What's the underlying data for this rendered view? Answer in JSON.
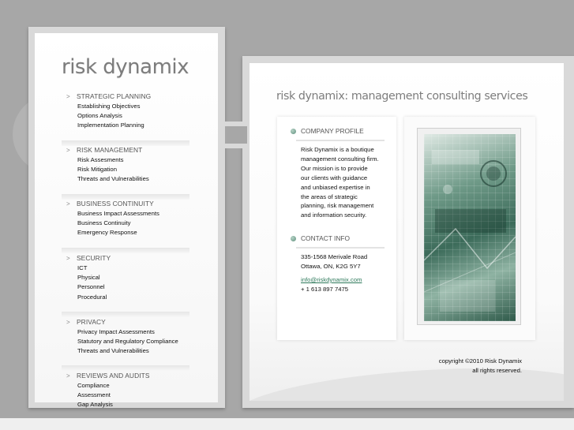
{
  "logo": "risk dynamix",
  "tagline": "risk dynamix: management consulting services",
  "nav": [
    {
      "title": "STRATEGIC PLANNING",
      "items": [
        "Establishing Objectives",
        "Options Analysis",
        "Implementation Planning"
      ]
    },
    {
      "title": "RISK MANAGEMENT",
      "items": [
        "Risk Assesments",
        "Risk Mitigation",
        "Threats and Vulnerabilities"
      ]
    },
    {
      "title": "BUSINESS CONTINUITY",
      "items": [
        "Business Impact Assessments",
        "Business Continuity",
        "Emergency Response"
      ]
    },
    {
      "title": "SECURITY",
      "items": [
        "ICT",
        "Physical",
        "Personnel",
        "Procedural"
      ]
    },
    {
      "title": "PRIVACY",
      "items": [
        "Privacy Impact Assessments",
        "Statutory and Regulatory Compliance",
        "Threats and Vulnerabilities"
      ]
    },
    {
      "title": "REVIEWS AND AUDITS",
      "items": [
        "Compliance",
        "Assessment",
        "Gap Analysis"
      ]
    }
  ],
  "company_profile": {
    "heading": "COMPANY PROFILE",
    "lines": [
      "Risk Dynamix is a boutique",
      "management consulting firm.",
      "Our mission is to provide",
      "our clients with guidance",
      "and unbiased expertise in",
      "the areas of strategic",
      "planning, risk management",
      "and information security."
    ]
  },
  "contact": {
    "heading": "CONTACT INFO",
    "address_line1": "335-1568 Merivale Road",
    "address_line2": "Ottawa, ON, K2G 5Y7",
    "email": "info@riskdynamix.com",
    "phone": "+ 1 613 897 7475"
  },
  "footer": {
    "copyright": "copyright ©2010 Risk Dynamix",
    "rights": "all rights reserved."
  },
  "icons": {
    "nav_arrow": "chevron-right-icon",
    "heading_bullet": "green-dot-icon"
  },
  "colors": {
    "background": "#a7a7a7",
    "accent_green": "#2f7a5c",
    "logo_gray": "#7c7c7c"
  }
}
